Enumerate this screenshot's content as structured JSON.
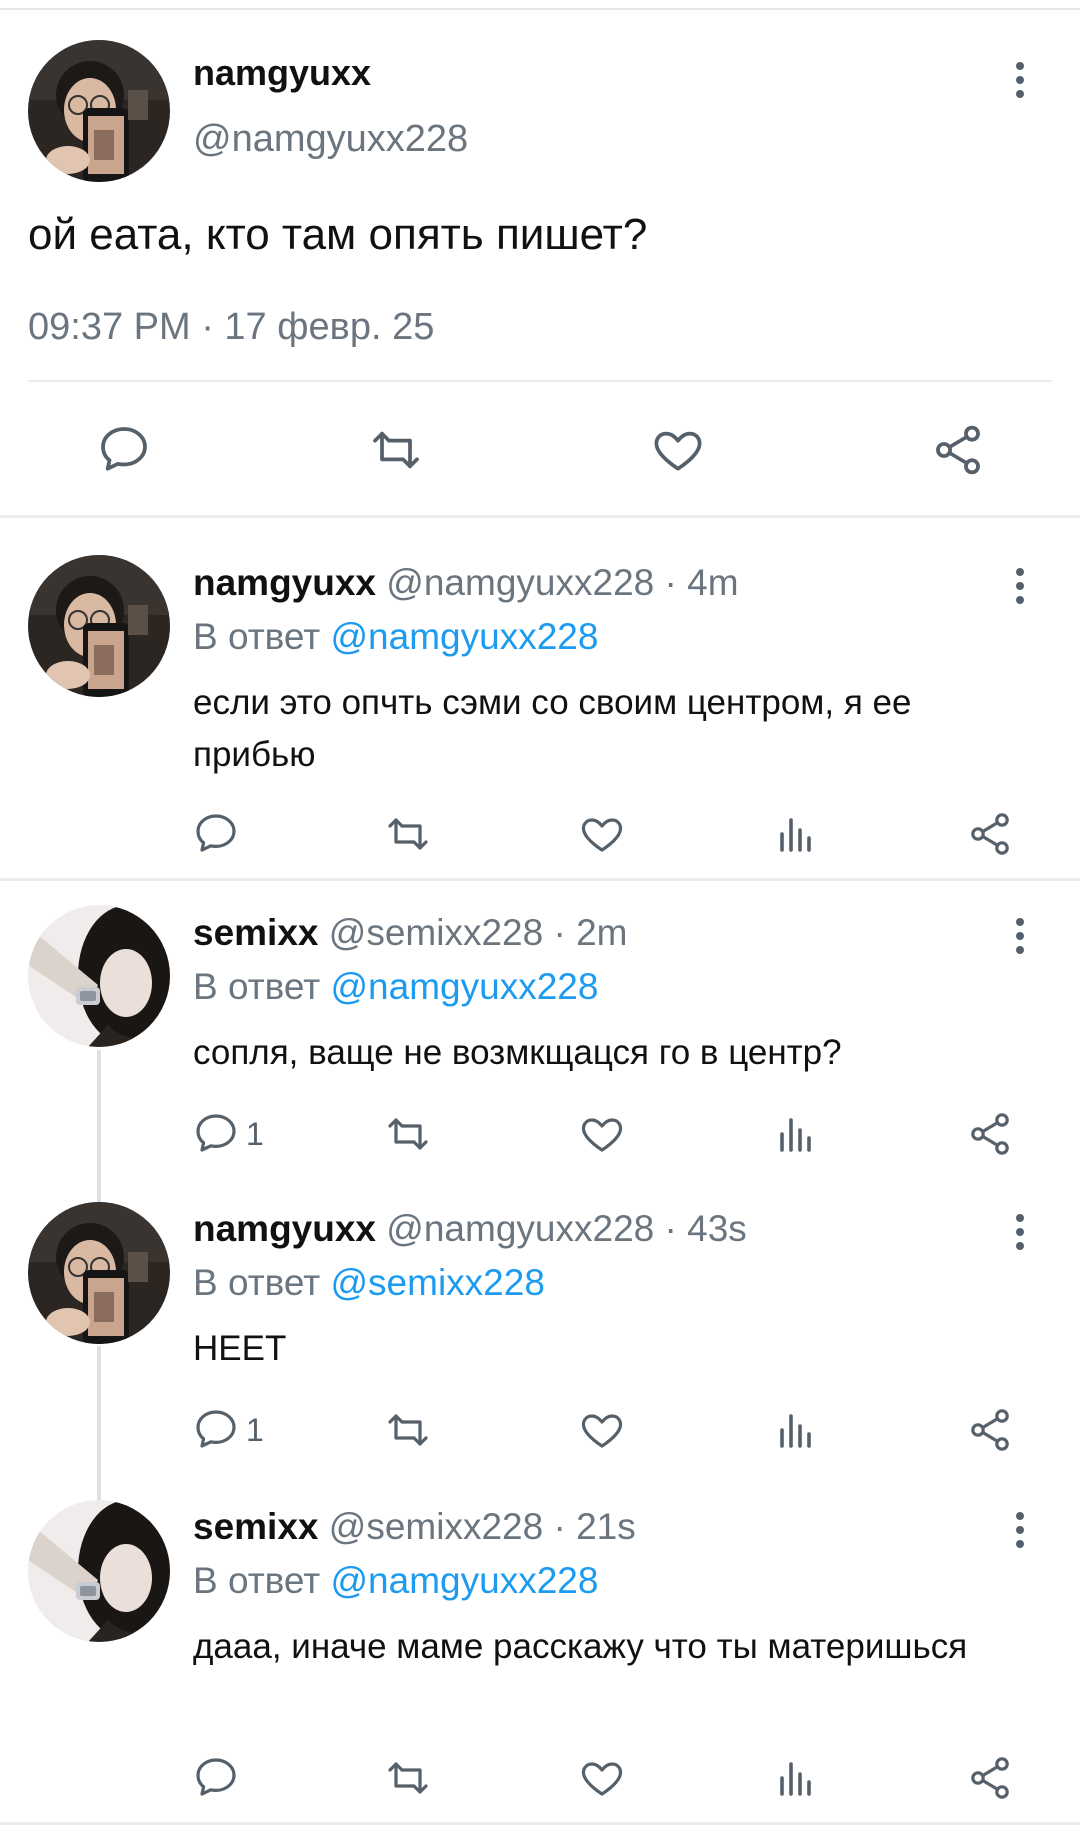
{
  "main_tweet": {
    "name": "namgyuxx",
    "handle": "@namgyuxx228",
    "text": "ой еата, кто там опять пишет?",
    "timestamp": "09:37 PM · 17 февр. 25"
  },
  "replies": [
    {
      "name": "namgyuxx",
      "handle": "@namgyuxx228",
      "dot": "·",
      "time": "4m",
      "reply_prefix": "В ответ",
      "reply_to": "@namgyuxx228",
      "text": "если это опчть сэми со своим центром, я ее прибью",
      "reply_count": ""
    },
    {
      "name": "semixx",
      "handle": "@semixx228",
      "dot": "·",
      "time": "2m",
      "reply_prefix": "В ответ",
      "reply_to": "@namgyuxx228",
      "text": "сопля, ваще не возмкщацся го в центр?",
      "reply_count": "1"
    },
    {
      "name": "namgyuxx",
      "handle": "@namgyuxx228",
      "dot": "·",
      "time": "43s",
      "reply_prefix": "В ответ",
      "reply_to": "@semixx228",
      "text": "НЕЕТ",
      "reply_count": "1"
    },
    {
      "name": "semixx",
      "handle": "@semixx228",
      "dot": "·",
      "time": "21s",
      "reply_prefix": "В ответ",
      "reply_to": "@namgyuxx228",
      "text": "дааа, иначе маме расскажу что ты материшься",
      "reply_count": ""
    }
  ],
  "icons": {
    "reply": "speech-bubble-icon",
    "retweet": "retweet-arrows-icon",
    "like": "heart-icon",
    "views": "bar-chart-icon",
    "share": "share-nodes-icon",
    "more": "vertical-dots-icon"
  },
  "colors": {
    "mention": "#1d9bf0",
    "secondary_text": "#6b7580",
    "divider": "#ececec"
  }
}
